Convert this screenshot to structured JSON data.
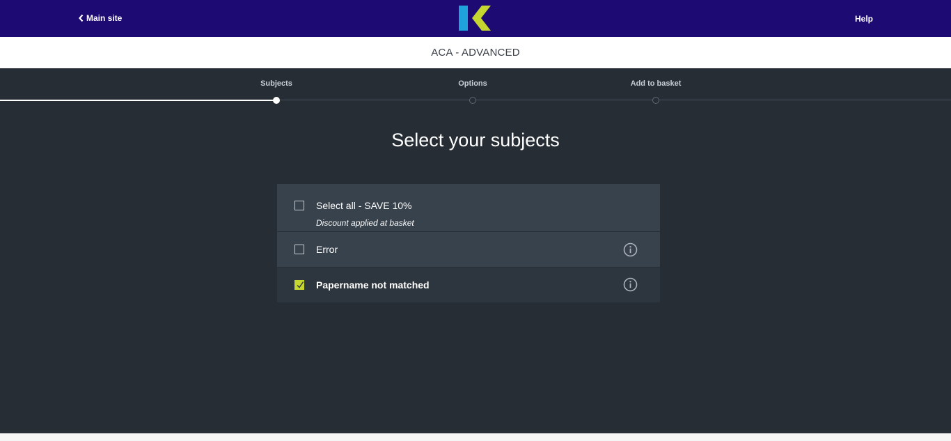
{
  "header": {
    "back_label": "Main site",
    "help_label": "Help",
    "logo_colors": {
      "bar": "#1fa3dd",
      "chevron": "#c6d631"
    },
    "background": "#1e0a73"
  },
  "course": {
    "title": "ACA - ADVANCED"
  },
  "steps": [
    {
      "label": "Subjects",
      "state": "active"
    },
    {
      "label": "Options",
      "state": "pending"
    },
    {
      "label": "Add to basket",
      "state": "pending"
    }
  ],
  "page": {
    "heading": "Select your subjects"
  },
  "subjects": {
    "select_all": {
      "label": "Select all - SAVE 10%",
      "note": "Discount applied at basket",
      "checked": false
    },
    "items": [
      {
        "label": "Error",
        "checked": false,
        "icon": "info-icon"
      },
      {
        "label": "Papername not matched",
        "checked": true,
        "icon": "info-icon"
      }
    ]
  },
  "colors": {
    "accent": "#c6d631",
    "panel": "#262d35",
    "row": "#38424d"
  }
}
